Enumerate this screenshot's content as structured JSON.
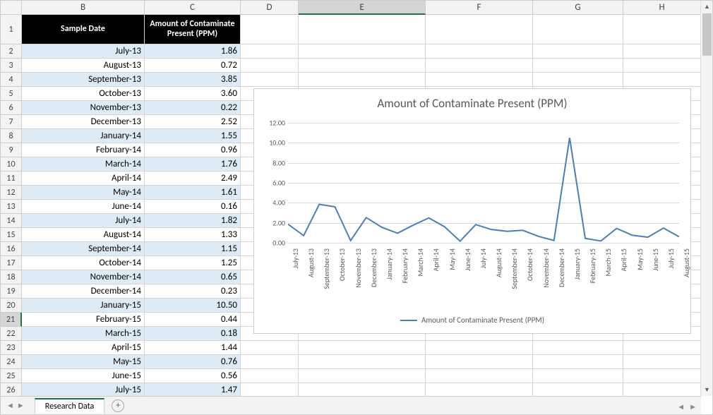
{
  "columns": [
    "B",
    "C",
    "D",
    "E",
    "F",
    "G",
    "H"
  ],
  "selected_column": "E",
  "selected_row": 21,
  "headers": {
    "B": "Sample Date",
    "C": "Amount of Contaminate Present (PPM)"
  },
  "rows": [
    {
      "n": 2,
      "date": "July-13",
      "val": "1.86",
      "band": true
    },
    {
      "n": 3,
      "date": "August-13",
      "val": "0.72",
      "band": false
    },
    {
      "n": 4,
      "date": "September-13",
      "val": "3.85",
      "band": true
    },
    {
      "n": 5,
      "date": "October-13",
      "val": "3.60",
      "band": false
    },
    {
      "n": 6,
      "date": "November-13",
      "val": "0.22",
      "band": true
    },
    {
      "n": 7,
      "date": "December-13",
      "val": "2.52",
      "band": false
    },
    {
      "n": 8,
      "date": "January-14",
      "val": "1.55",
      "band": true
    },
    {
      "n": 9,
      "date": "February-14",
      "val": "0.96",
      "band": false
    },
    {
      "n": 10,
      "date": "March-14",
      "val": "1.76",
      "band": true
    },
    {
      "n": 11,
      "date": "April-14",
      "val": "2.49",
      "band": false
    },
    {
      "n": 12,
      "date": "May-14",
      "val": "1.61",
      "band": true
    },
    {
      "n": 13,
      "date": "June-14",
      "val": "0.16",
      "band": false
    },
    {
      "n": 14,
      "date": "July-14",
      "val": "1.82",
      "band": true
    },
    {
      "n": 15,
      "date": "August-14",
      "val": "1.33",
      "band": false
    },
    {
      "n": 16,
      "date": "September-14",
      "val": "1.15",
      "band": true
    },
    {
      "n": 17,
      "date": "October-14",
      "val": "1.25",
      "band": false
    },
    {
      "n": 18,
      "date": "November-14",
      "val": "0.65",
      "band": true
    },
    {
      "n": 19,
      "date": "December-14",
      "val": "0.23",
      "band": false
    },
    {
      "n": 20,
      "date": "January-15",
      "val": "10.50",
      "band": true
    },
    {
      "n": 21,
      "date": "February-15",
      "val": "0.44",
      "band": false
    },
    {
      "n": 22,
      "date": "March-15",
      "val": "0.18",
      "band": true
    },
    {
      "n": 23,
      "date": "April-15",
      "val": "1.44",
      "band": false
    },
    {
      "n": 24,
      "date": "May-15",
      "val": "0.76",
      "band": true
    },
    {
      "n": 25,
      "date": "June-15",
      "val": "0.56",
      "band": false
    },
    {
      "n": 26,
      "date": "July-15",
      "val": "1.47",
      "band": true
    }
  ],
  "sheet_tab": "Research Data",
  "chart_data": {
    "type": "line",
    "title": "Amount of Contaminate Present (PPM)",
    "legend": "Amount of Contaminate Present (PPM)",
    "ylim": [
      0,
      12
    ],
    "yticks": [
      0,
      2,
      4,
      6,
      8,
      10,
      12
    ],
    "categories": [
      "July-13",
      "August-13",
      "September-13",
      "October-13",
      "November-13",
      "December-13",
      "January-14",
      "February-14",
      "March-14",
      "April-14",
      "May-14",
      "June-14",
      "July-14",
      "August-14",
      "September-14",
      "October-14",
      "November-14",
      "December-14",
      "January-15",
      "February-15",
      "March-15",
      "April-15",
      "May-15",
      "June-15",
      "July-15",
      "August-15"
    ],
    "values": [
      1.86,
      0.72,
      3.85,
      3.6,
      0.22,
      2.52,
      1.55,
      0.96,
      1.76,
      2.49,
      1.61,
      0.16,
      1.82,
      1.33,
      1.15,
      1.25,
      0.65,
      0.23,
      10.5,
      0.44,
      0.18,
      1.44,
      0.76,
      0.56,
      1.47,
      0.6
    ],
    "line_color": "#4a7ebb"
  }
}
